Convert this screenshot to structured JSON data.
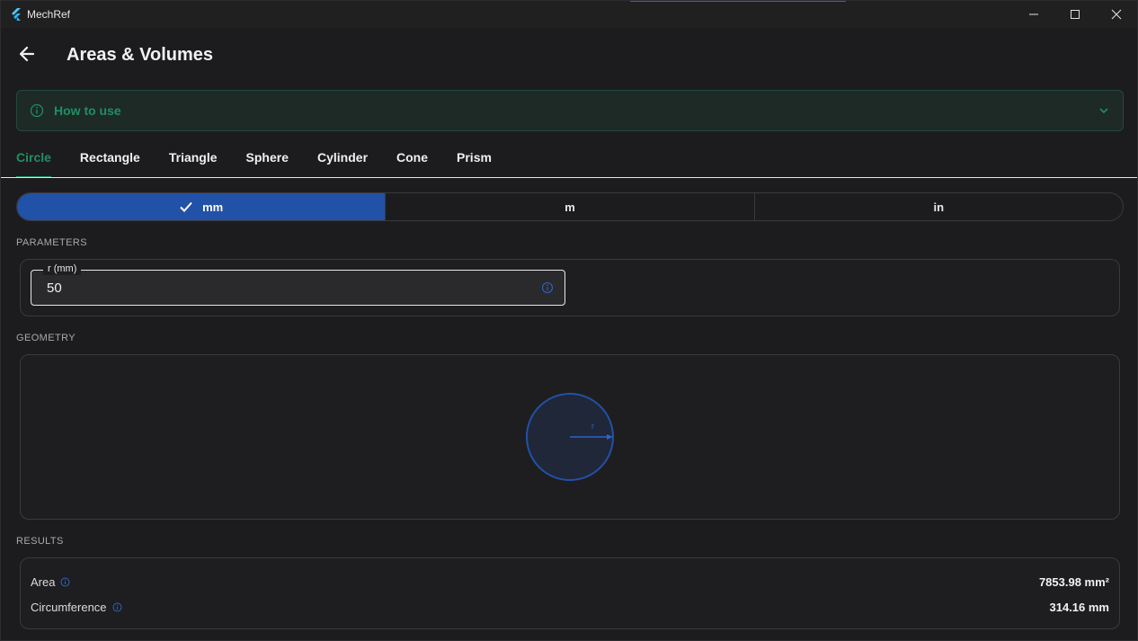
{
  "window": {
    "title": "MechRef",
    "logo_icon": "flutter-logo-icon"
  },
  "header": {
    "title": "Areas & Volumes"
  },
  "howto": {
    "label": "How to use"
  },
  "tabs": [
    {
      "label": "Circle",
      "active": true
    },
    {
      "label": "Rectangle"
    },
    {
      "label": "Triangle"
    },
    {
      "label": "Sphere"
    },
    {
      "label": "Cylinder"
    },
    {
      "label": "Cone"
    },
    {
      "label": "Prism"
    }
  ],
  "units": [
    {
      "label": "mm",
      "selected": true
    },
    {
      "label": "m"
    },
    {
      "label": "in"
    }
  ],
  "sections": {
    "parameters": "PARAMETERS",
    "geometry": "GEOMETRY",
    "results": "RESULTS"
  },
  "parameters": {
    "r_label": "r  (mm)",
    "r_value": "50"
  },
  "geometry": {
    "radius_label": "r"
  },
  "results": [
    {
      "name": "Area",
      "value": "7853.98 mm²"
    },
    {
      "name": "Circumference",
      "value": "314.16 mm"
    }
  ],
  "colors": {
    "accent_green": "#1f8f63",
    "accent_blue": "#2251a8",
    "background": "#1c1c1e"
  }
}
